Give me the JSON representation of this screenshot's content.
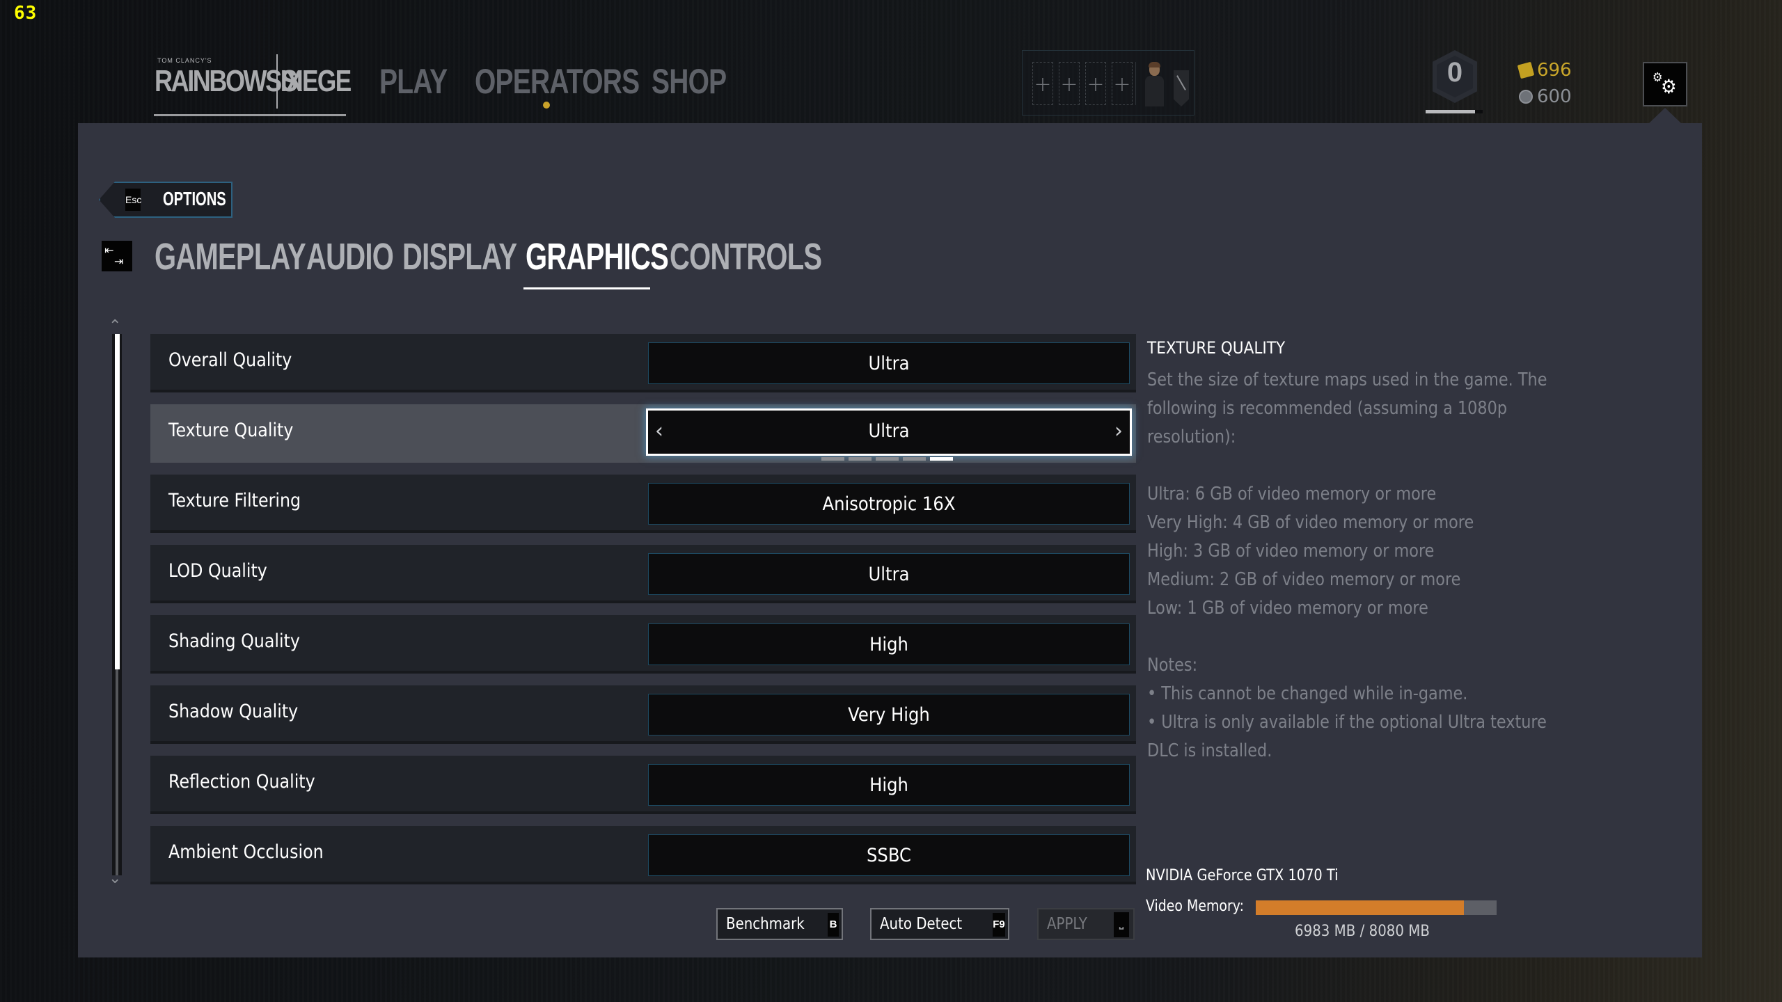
{
  "overlay": {
    "fps": "63"
  },
  "header": {
    "logo": {
      "publisher": "TOM CLANCY'S",
      "title_left": "RAINBOWSIX",
      "title_right": "SIEGE"
    },
    "nav": [
      {
        "label": "PLAY",
        "notification": false
      },
      {
        "label": "OPERATORS",
        "notification": true
      },
      {
        "label": "SHOP",
        "notification": false
      }
    ],
    "squad": {
      "slots": [
        "+",
        "+",
        "+",
        "+"
      ]
    },
    "rank": {
      "level": "0",
      "progress": 0.87
    },
    "currency": {
      "credits": "696",
      "renown": "600"
    },
    "colors": {
      "credits": "#c9a62a",
      "renown": "#8b8f95",
      "notification": "#c9a22a"
    }
  },
  "options": {
    "back": {
      "key": "Esc",
      "label": "OPTIONS"
    },
    "tabs": [
      {
        "label": "GAMEPLAY",
        "active": false
      },
      {
        "label": "AUDIO",
        "active": false
      },
      {
        "label": "DISPLAY",
        "active": false
      },
      {
        "label": "GRAPHICS",
        "active": true
      },
      {
        "label": "CONTROLS",
        "active": false
      }
    ],
    "scroll": {
      "position": 0.0,
      "visible_fraction": 0.62
    },
    "settings": [
      {
        "label": "Overall Quality",
        "value": "Ultra"
      },
      {
        "label": "Texture Quality",
        "value": "Ultra",
        "selected": true,
        "level": 5,
        "levels": 5
      },
      {
        "label": "Texture Filtering",
        "value": "Anisotropic 16X"
      },
      {
        "label": "LOD Quality",
        "value": "Ultra"
      },
      {
        "label": "Shading Quality",
        "value": "High"
      },
      {
        "label": "Shadow Quality",
        "value": "Very High"
      },
      {
        "label": "Reflection Quality",
        "value": "High"
      },
      {
        "label": "Ambient Occlusion",
        "value": "SSBC"
      }
    ],
    "description": {
      "title": "TEXTURE QUALITY",
      "intro": [
        "Set the size of texture maps used in the game. The",
        "following is recommended (assuming a 1080p",
        "resolution):"
      ],
      "recommendations": [
        "Ultra: 6 GB of video memory or more",
        "Very High: 4 GB of video memory or more",
        "High: 3 GB of video memory or more",
        "Medium: 2 GB of video memory or more",
        "Low: 1 GB of video memory or more"
      ],
      "notes_title": "Notes:",
      "notes": [
        "• This cannot be changed while in-game.",
        "• Ultra is only available if the optional Ultra texture",
        "DLC is installed."
      ]
    },
    "gpu": {
      "name": "NVIDIA GeForce GTX 1070 Ti",
      "memory_label": "Video Memory:",
      "memory_used_mb": 6983,
      "memory_total_mb": 8080,
      "memory_text": "6983 MB / 8080 MB",
      "bar_color": "#d37d2a"
    },
    "buttons": {
      "benchmark": {
        "label": "Benchmark",
        "key": "B"
      },
      "auto_detect": {
        "label": "Auto Detect",
        "key": "F9"
      },
      "apply": {
        "label": "APPLY",
        "key": "⎵",
        "enabled": false
      }
    }
  }
}
